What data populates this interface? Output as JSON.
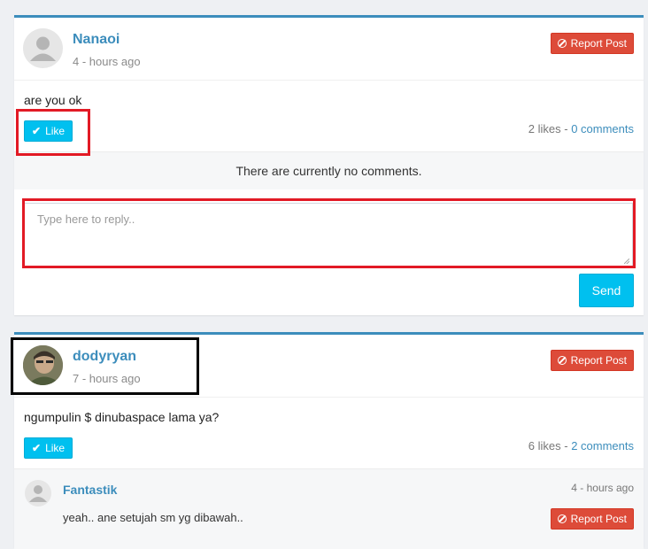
{
  "posts": [
    {
      "username": "Nanaoi",
      "time": "4 - hours ago",
      "text": "are you ok",
      "report_label": "Report Post",
      "like_label": "Like",
      "likes_text": "2 likes - ",
      "comments_link": "0 comments",
      "no_comments": "There are currently no comments.",
      "reply_placeholder": "Type here to reply..",
      "send_label": "Send"
    },
    {
      "username": "dodyryan",
      "time": "7 - hours ago",
      "text": "ngumpulin $ dinubaspace lama ya?",
      "report_label": "Report Post",
      "like_label": "Like",
      "likes_text": "6 likes - ",
      "comments_link": "2 comments",
      "comment": {
        "username": "Fantastik",
        "time": "4 - hours ago",
        "text": "yeah.. ane setujah sm yg dibawah..",
        "report_label": "Report Post"
      }
    }
  ],
  "colors": {
    "accent": "#3c8dbc",
    "like": "#00c0ef",
    "report": "#dd4b39",
    "highlight_red": "#e21a25",
    "highlight_black": "#000000"
  },
  "icons": {
    "report": "ban-icon",
    "like": "check-icon",
    "avatar_default": "user-silhouette-icon"
  }
}
